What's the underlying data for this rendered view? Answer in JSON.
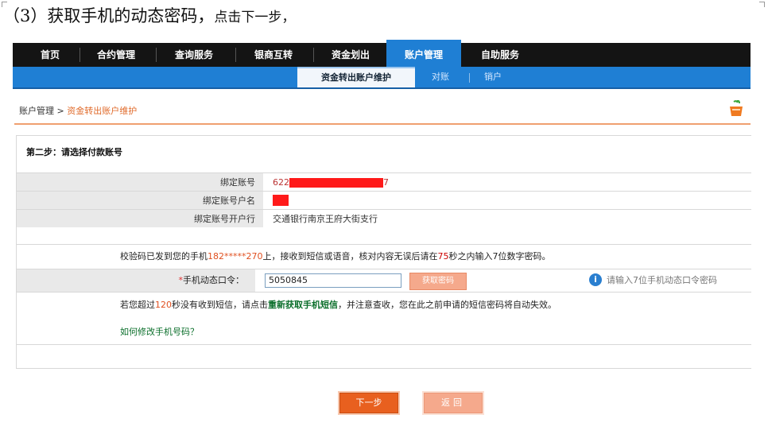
{
  "instruction": {
    "prefix": "（3）获取手机的动态密码，",
    "suffix": "点击下一步，"
  },
  "top_nav": {
    "items": [
      "首页",
      "合约管理",
      "查询服务",
      "银商互转",
      "资金划出",
      "账户管理",
      "自助服务"
    ],
    "active_index": 5
  },
  "sub_nav": {
    "items": [
      "资金转出账户维护",
      "对账",
      "销户"
    ],
    "active_index": 0
  },
  "breadcrumb": {
    "root": "账户管理",
    "separator": ">",
    "current": "资金转出账户维护"
  },
  "form": {
    "step_title": "第二步：请选择付款账号",
    "rows": [
      {
        "label": "绑定账号",
        "value_prefix": "622",
        "value_suffix": "7"
      },
      {
        "label": "绑定账号户名",
        "value_prefix": "",
        "value_suffix": ""
      },
      {
        "label": "绑定账号开户行",
        "value": "交通银行南京王府大街支行"
      }
    ],
    "sent_msg": {
      "part1": "校验码已发到您的手机",
      "phone": "182*****270",
      "part2": "上，接收到短信或语音，核对内容无误后请在",
      "seconds": "75",
      "part3": "秒之内输入7位数字密码。"
    },
    "otp": {
      "required_mark": "*",
      "label": "手机动态口令：",
      "value": "5050845",
      "resend_label": "获取密码",
      "hint_icon": "info-icon",
      "hint": "请输入7位手机动态口令密码"
    },
    "notice": {
      "part1": "若您超过",
      "seconds": "120",
      "part2": "秒没有收到短信，请点击",
      "link": "重新获取手机短信",
      "part3": "，并注意查收，您在此之前申请的短信密码将自动失效。"
    },
    "change_phone_link": "如何修改手机号码？"
  },
  "buttons": {
    "next": "下一步",
    "back": "返回"
  },
  "colors": {
    "nav_bg": "#141414",
    "nav_active": "#1f7fd4",
    "accent_orange": "#e8601f",
    "redaction": "#ff1a1a"
  }
}
